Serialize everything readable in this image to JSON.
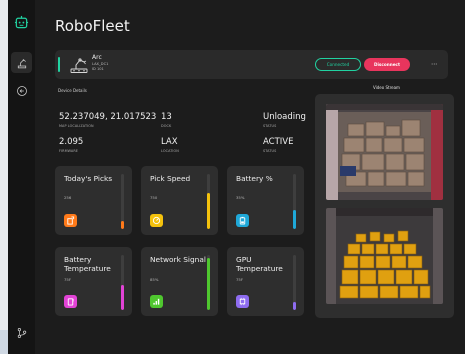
{
  "app": {
    "title": "RoboFleet"
  },
  "robot": {
    "name": "Arc",
    "location": "LAX_DC1",
    "id": "ID 101",
    "connected_label": "Connected",
    "disconnect_label": "Disconnect",
    "more_label": "···"
  },
  "details": {
    "section_label": "Device Details",
    "items": [
      {
        "value": "52.237049, 21.017523",
        "key": "MAP LOCALIZATION"
      },
      {
        "value": "13",
        "key": "DOCK"
      },
      {
        "value": "Unloading",
        "key": "STATUS"
      },
      {
        "value": "2.095",
        "key": "FIRMWARE"
      },
      {
        "value": "LAX",
        "key": "LOCATION"
      },
      {
        "value": "ACTIVE",
        "key": "STATUS"
      }
    ]
  },
  "metrics": [
    {
      "title": "Today's Picks",
      "value": "256",
      "icon": "picks-icon",
      "color": "#ff7a1a",
      "level": 0.15
    },
    {
      "title": "Pick Speed",
      "value": "750",
      "icon": "speed-icon",
      "color": "#f4c20d",
      "level": 0.65
    },
    {
      "title": "Battery %",
      "value": "35%",
      "icon": "battery-icon",
      "color": "#1fa8d8",
      "level": 0.35
    },
    {
      "title": "Battery Temperature",
      "value": "75F",
      "icon": "thermometer-icon",
      "color": "#e243d6",
      "level": 0.45
    },
    {
      "title": "Network Signal",
      "value": "85%",
      "icon": "signal-icon",
      "color": "#4fc72f",
      "level": 0.95
    },
    {
      "title": "GPU Temperature",
      "value": "75F",
      "icon": "gpu-temp-icon",
      "color": "#8e6cf0",
      "level": 0.15
    }
  ],
  "video": {
    "label": "Video Stream"
  }
}
